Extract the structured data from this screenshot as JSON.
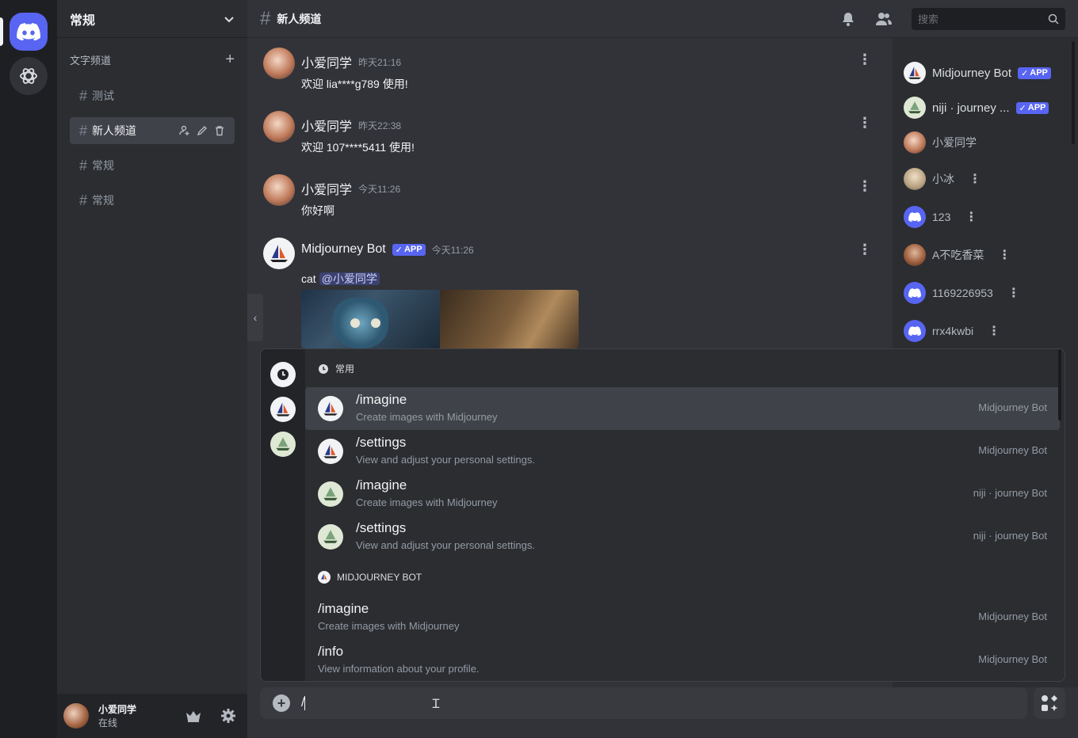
{
  "guild": {
    "name": "常规"
  },
  "sidebar": {
    "category_label": "文字频道",
    "channels": [
      {
        "name": "测试"
      },
      {
        "name": "新人频道"
      },
      {
        "name": "常规"
      },
      {
        "name": "常规"
      }
    ]
  },
  "user": {
    "name": "小爱同学",
    "status": "在线"
  },
  "header": {
    "channel_name": "新人频道",
    "search_placeholder": "搜索"
  },
  "messages": [
    {
      "author": "小爱同学",
      "time": "昨天21:16",
      "text": "欢迎 lia****g789 使用!"
    },
    {
      "author": "小爱同学",
      "time": "昨天22:38",
      "text": "欢迎 107****5411 使用!"
    },
    {
      "author": "小爱同学",
      "time": "今天11:26",
      "text": "你好啊"
    },
    {
      "author": "Midjourney Bot",
      "badge": "APP",
      "time": "今天11:26",
      "text": "cat",
      "mention": "@小爱同学"
    }
  ],
  "members": [
    {
      "name": "Midjourney Bot",
      "badge": "APP"
    },
    {
      "name": "niji · journey ...",
      "badge": "APP"
    },
    {
      "name": "小爱同学"
    },
    {
      "name": "小冰"
    },
    {
      "name": "123"
    },
    {
      "name": "A不吃香菜"
    },
    {
      "name": "1169226953"
    },
    {
      "name": "rrx4kwbi"
    }
  ],
  "popup": {
    "frequent_label": "常用",
    "frequent": [
      {
        "name": "/imagine",
        "desc": "Create images with Midjourney",
        "source": "Midjourney Bot"
      },
      {
        "name": "/settings",
        "desc": "View and adjust your personal settings.",
        "source": "Midjourney Bot"
      },
      {
        "name": "/imagine",
        "desc": "Create images with Midjourney",
        "source": "niji · journey Bot"
      },
      {
        "name": "/settings",
        "desc": "View and adjust your personal settings.",
        "source": "niji · journey Bot"
      }
    ],
    "bot_section_label": "MIDJOURNEY BOT",
    "bot_commands": [
      {
        "name": "/imagine",
        "desc": "Create images with Midjourney",
        "source": "Midjourney Bot"
      },
      {
        "name": "/info",
        "desc": "View information about your profile.",
        "source": "Midjourney Bot"
      }
    ]
  },
  "composer": {
    "value": "/"
  },
  "colors": {
    "brand": "#5865f2",
    "background": "#313338",
    "sidebar": "#2b2d31",
    "rail": "#1e1f22"
  }
}
